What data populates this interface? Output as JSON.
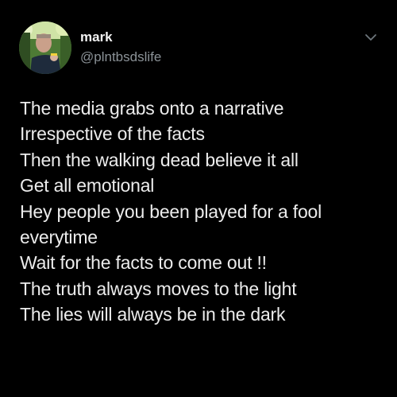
{
  "user": {
    "name": "mark",
    "handle": "@plntbsdslife"
  },
  "icons": {
    "menu": "chevron-down-icon"
  },
  "colors": {
    "background": "#000000",
    "text": "#ececec",
    "handle": "#8b9297"
  },
  "tweet": {
    "lines": [
      "The media grabs onto a narrative",
      "Irrespective of the facts",
      "Then the walking dead believe it all",
      "Get all emotional",
      "Hey people you been played for a fool",
      "everytime",
      "Wait for the facts to come out !!",
      "The truth always moves to the light",
      "The lies will always be in the dark"
    ]
  }
}
